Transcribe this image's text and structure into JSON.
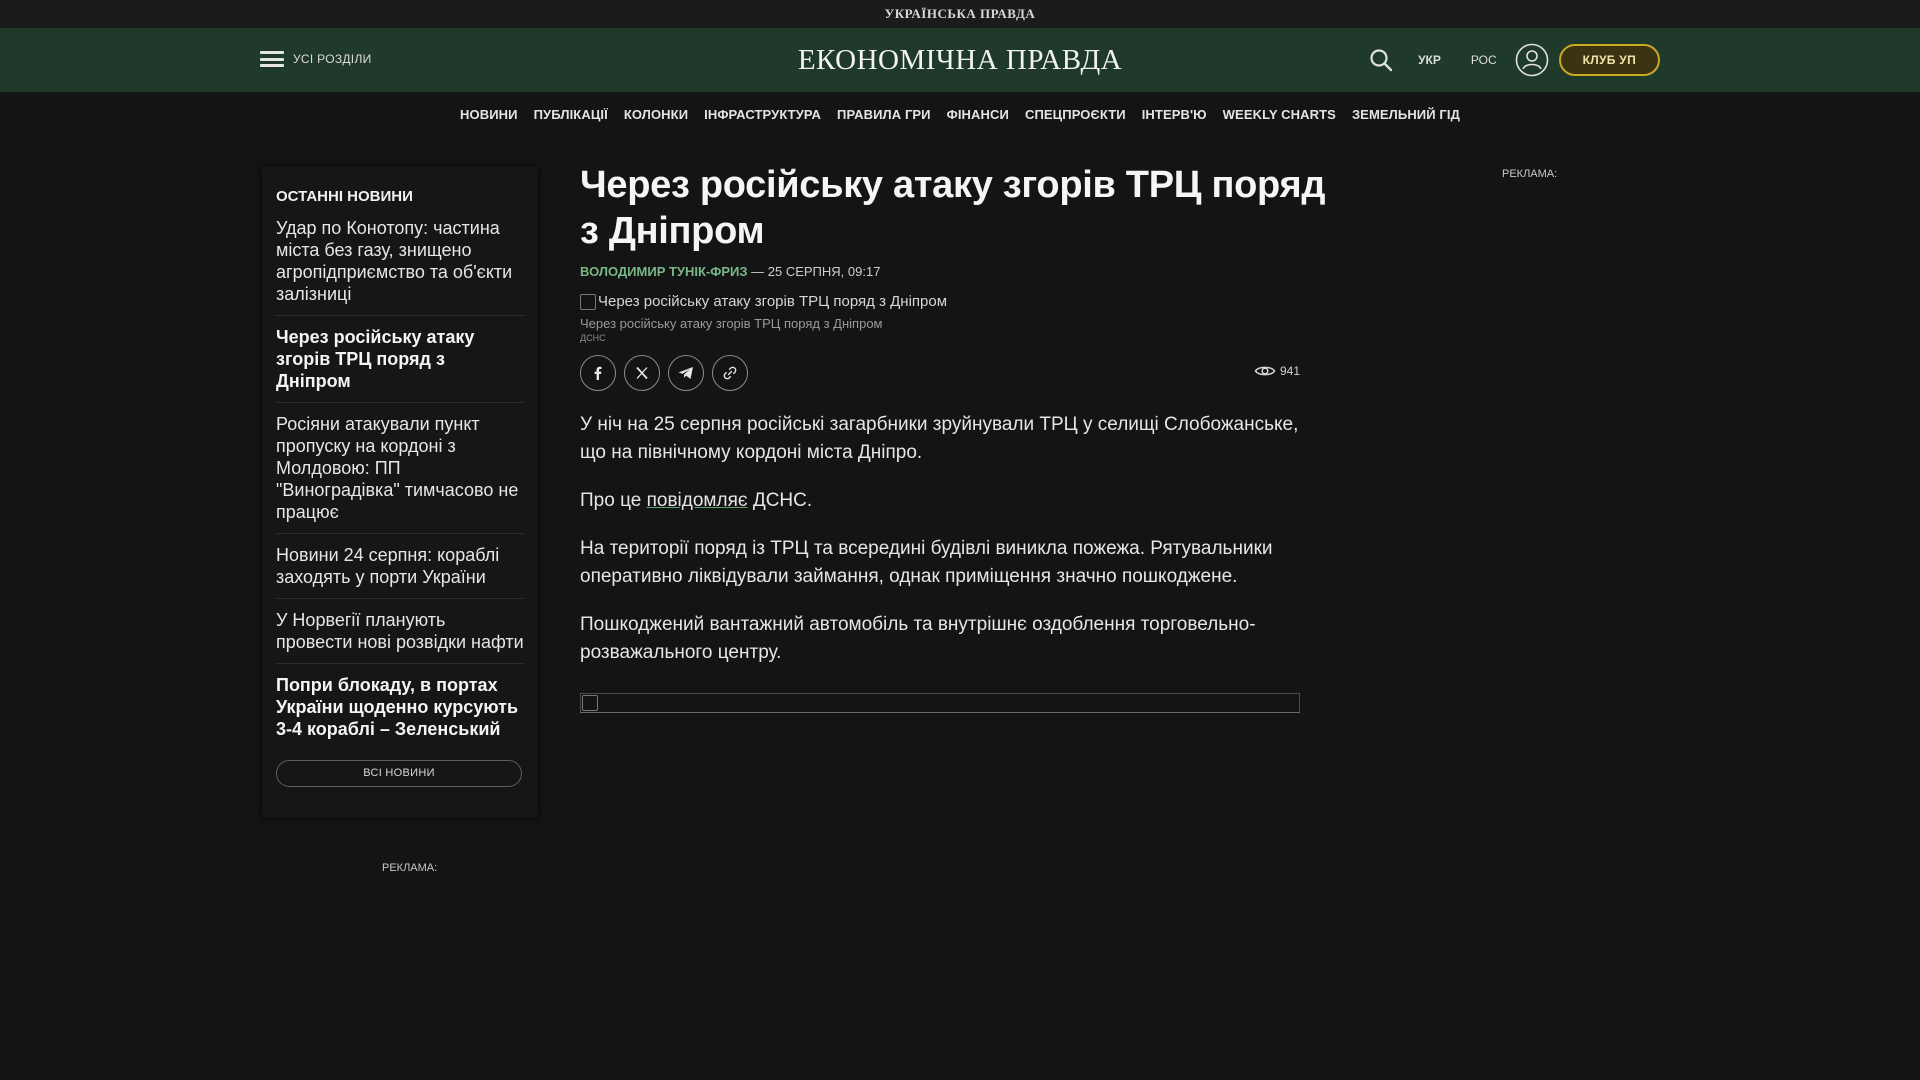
{
  "topstrip": {
    "brand": "УКРАЇНСЬКА ПРАВДА"
  },
  "header": {
    "menu_label": "УСІ РОЗДІЛИ",
    "logo": "ЕКОНОМІЧНА ПРАВДА",
    "lang_ukr": "УКР",
    "lang_rus": "РОС",
    "club_label": "КЛУБ УП",
    "accent_color": "#1f3a2a",
    "club_color": "#c9a825"
  },
  "nav": {
    "items": [
      "НОВИНИ",
      "ПУБЛІКАЦІЇ",
      "КОЛОНКИ",
      "ІНФРАСТРУКТУРА",
      "ПРАВИЛА ГРИ",
      "ФІНАНСИ",
      "СПЕЦПРОЄКТИ",
      "ІНТЕРВ'Ю",
      "WEEKLY CHARTS",
      "ЗЕМЕЛЬНИЙ ГІД"
    ]
  },
  "sidebar": {
    "title": "ОСТАННІ НОВИНИ",
    "items": [
      "Удар по Конотопу: частина міста без газу, знищено агропідприємство та об'єкти залізниці",
      "Через російську атаку згорів ТРЦ поряд з Дніпром",
      "Росіяни атакували пункт пропуску на кордоні з Молдовою: ПП \"Виноградівка\" тимчасово не працює",
      "Новини 24 серпня: кораблі заходять у порти України",
      "У Норвегії планують провести нові розвідки нафти",
      "Попри блокаду, в портах України щоденно курсують 3-4 кораблі – Зеленський"
    ],
    "all_news": "ВСІ НОВИНИ"
  },
  "ads": {
    "left": "РЕКЛАМА:",
    "right": "РЕКЛАМА:"
  },
  "article": {
    "headline": "Через російську атаку згорів ТРЦ поряд з Дніпром",
    "author": "ВОЛОДИМИР ТУНІК-ФРИЗ",
    "date": " — 25 СЕРПНЯ, 09:17",
    "image_alt": "Через російську атаку згорів ТРЦ поряд з Дніпром",
    "caption": "Через російську атаку згорів ТРЦ поряд з Дніпром",
    "credit": "ДСНС",
    "views": "941",
    "p1": "У ніч на 25 серпня російські загарбники зруйнували ТРЦ у селищі Слобожанське, що на північному кордоні міста Дніпро.",
    "p2_before": "Про це ",
    "p2_link": "повідомляє",
    "p2_after": " ДСНС.",
    "p3": "На території поряд із ТРЦ та всередині будівлі виникла пожежа. Рятувальники оперативно ліквідували займання, однак приміщення значно пошкоджене.",
    "p4": "Пошкоджений вантажний автомобіль та внутрішнє оздоблення торговельно-розважального центру."
  }
}
